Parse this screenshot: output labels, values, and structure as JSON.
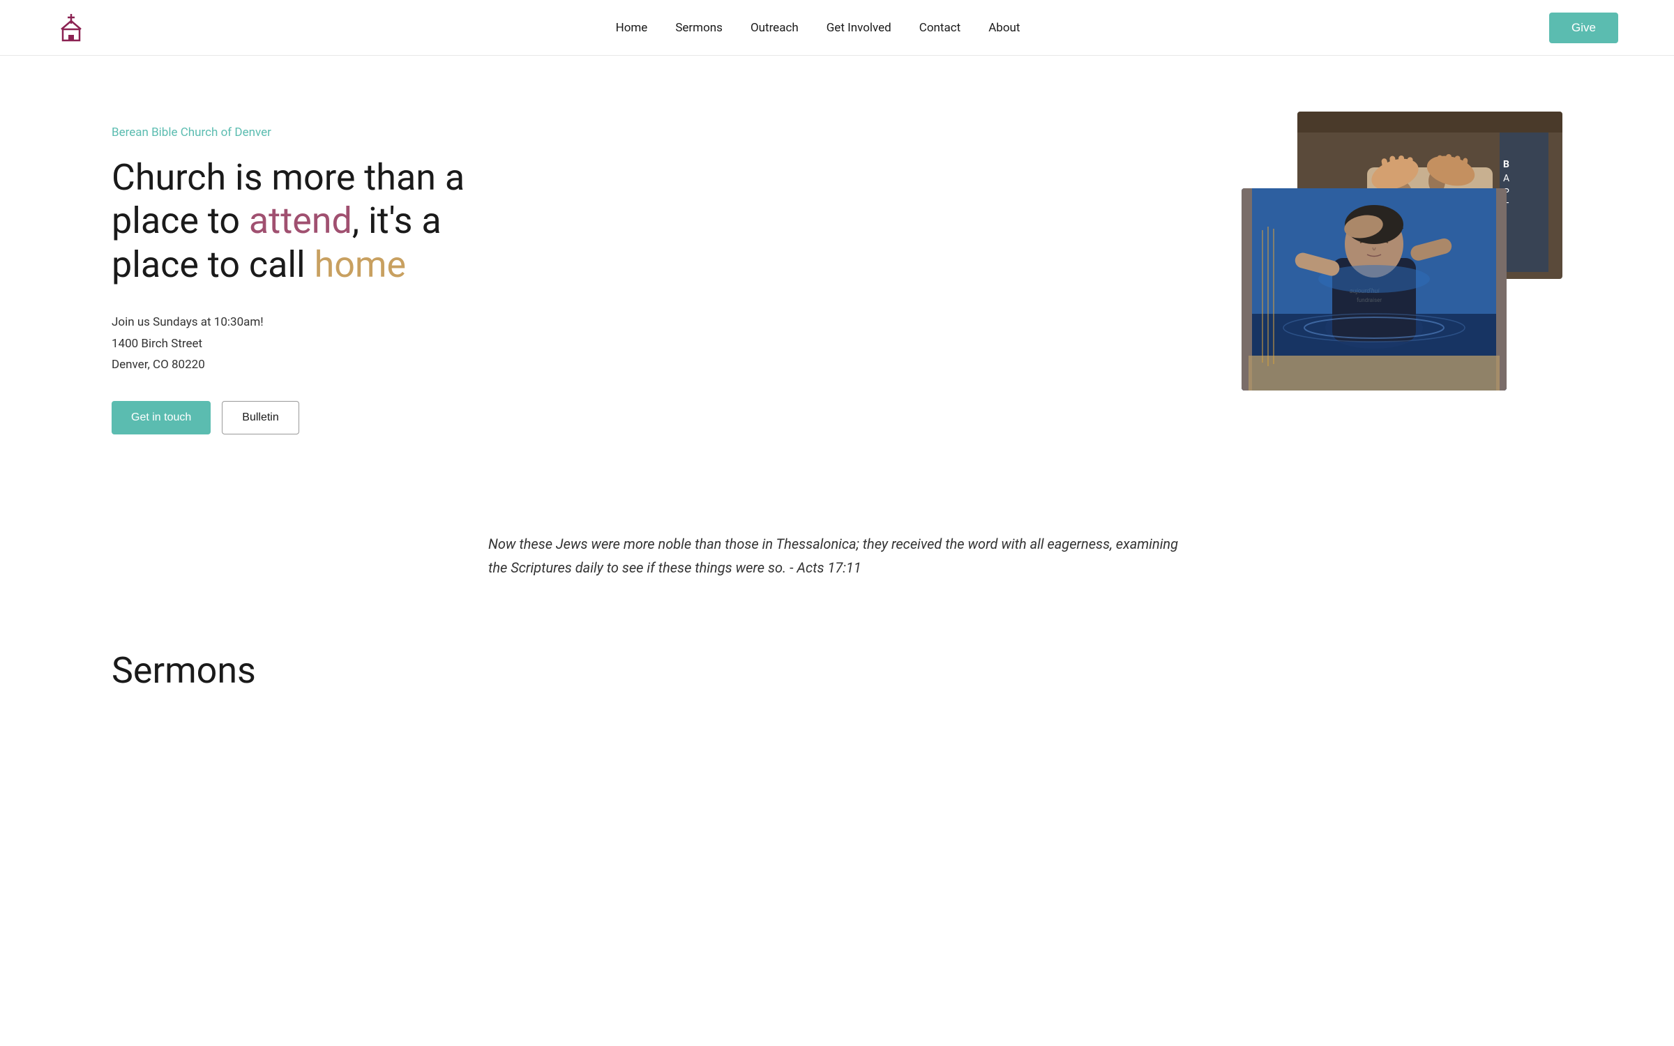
{
  "nav": {
    "items": [
      {
        "label": "Home",
        "href": "#"
      },
      {
        "label": "Sermons",
        "href": "#"
      },
      {
        "label": "Outreach",
        "href": "#"
      },
      {
        "label": "Get Involved",
        "href": "#"
      },
      {
        "label": "Contact",
        "href": "#"
      },
      {
        "label": "About",
        "href": "#"
      }
    ],
    "give_label": "Give"
  },
  "hero": {
    "church_name": "Berean Bible Church of Denver",
    "heading_part1": "Church is more than a place to ",
    "heading_attend": "attend",
    "heading_part2": ", it's a place to call ",
    "heading_home": "home",
    "address_line1": "Join us Sundays at 10:30am!",
    "address_line2": "1400 Birch Street",
    "address_line3": "Denver, CO 80220",
    "btn_contact": "Get in touch",
    "btn_bulletin": "Bulletin"
  },
  "quote": {
    "text": "Now these Jews were more noble than those in Thessalonica; they received the word with all eagerness, examining the Scriptures daily to see if these things were so. - Acts  17:11"
  },
  "sermons": {
    "heading": "Sermons"
  },
  "colors": {
    "teal": "#5bbcb0",
    "maroon": "#a05070",
    "gold": "#c8a060",
    "church_icon": "#8b2252"
  }
}
